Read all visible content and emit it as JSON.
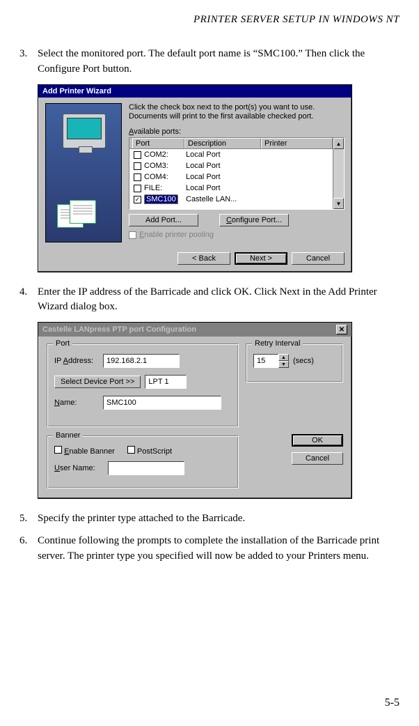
{
  "running_head": "PRINTER SERVER SETUP IN WINDOWS NT",
  "steps": {
    "s3_num": "3.",
    "s3_text": "Select the monitored port. The default port name is “SMC100.” Then click the Configure Port button.",
    "s4_num": "4.",
    "s4_text": "Enter the IP address of the Barricade and click OK. Click Next in the Add Printer Wizard dialog box.",
    "s5_num": "5.",
    "s5_text": "Specify the printer type attached to the Barricade.",
    "s6_num": "6.",
    "s6_text": "Continue following the prompts to complete the installation of the Barricade print server. The printer type you specified will now be added to your Printers menu."
  },
  "dlg1": {
    "title": "Add Printer Wizard",
    "instr1": "Click the check box next to the port(s) you want to use.",
    "instr2": "Documents will print to the first available checked port.",
    "available_label": "Available ports:",
    "col_port": "Port",
    "col_desc": "Description",
    "col_printer": "Printer",
    "rows": {
      "r0_port": "COM2:",
      "r0_desc": "Local Port",
      "r1_port": "COM3:",
      "r1_desc": "Local Port",
      "r2_port": "COM4:",
      "r2_desc": "Local Port",
      "r3_port": "FILE:",
      "r3_desc": "Local Port",
      "r4_port": "SMC100",
      "r4_desc": "Castelle LAN..."
    },
    "add_port": "Add Port...",
    "configure_port": "Configure Port...",
    "enable_pooling": "Enable printer pooling",
    "back": "< Back",
    "next": "Next >",
    "cancel": "Cancel"
  },
  "dlg2": {
    "title": "Castelle LANpress PTP port  Configuration",
    "group_port": "Port",
    "ip_label": "IP Address:",
    "ip_value": "192.168.2.1",
    "select_device": "Select Device Port >>",
    "device_port_value": "LPT 1",
    "name_label": "Name:",
    "name_value": "SMC100",
    "group_retry": "Retry Interval",
    "retry_value": "15",
    "retry_unit": "(secs)",
    "group_banner": "Banner",
    "enable_banner": "Enable Banner",
    "postscript": "PostScript",
    "user_name": "User Name:",
    "ok": "OK",
    "cancel": "Cancel"
  },
  "page_number": "5-5"
}
